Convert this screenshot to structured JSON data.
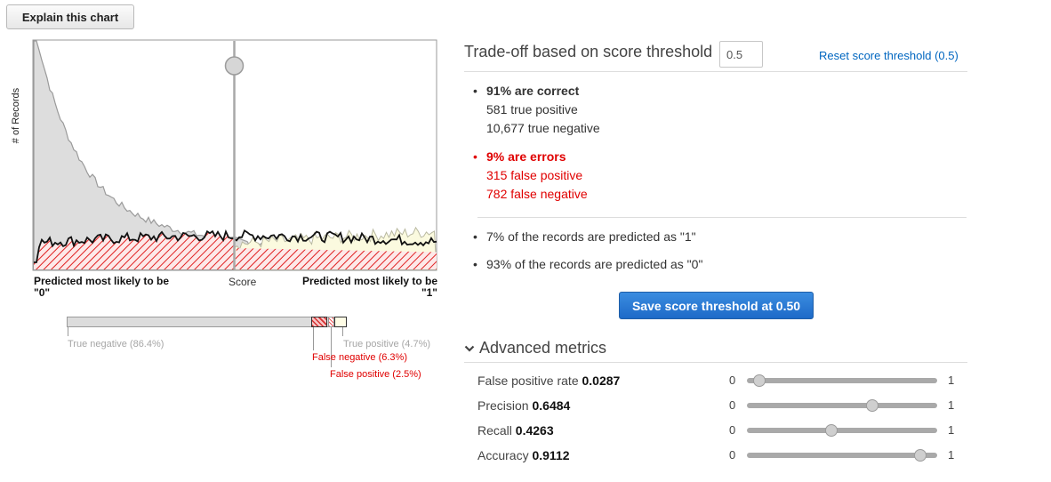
{
  "explain_button": "Explain this chart",
  "chart": {
    "ylabel": "# of Records",
    "xlabel_left_1": "Predicted most likely to be",
    "xlabel_left_2": "\"0\"",
    "xlabel_mid": "Score",
    "xlabel_right_1": "Predicted most likely to be",
    "xlabel_right_2": "\"1\"",
    "threshold": 0.5,
    "colors": {
      "negative_fill": "#dddddd",
      "positive_fill": "#fbfadf",
      "error_hatch": "#e02020",
      "error_line": "#111111"
    }
  },
  "proportions": {
    "true_negative": "True negative (86.4%)",
    "false_negative": "False negative (6.3%)",
    "false_positive": "False positive (2.5%)",
    "true_positive": "True positive (4.7%)",
    "values": {
      "true_negative": 86.4,
      "false_negative": 6.3,
      "false_positive": 2.5,
      "true_positive": 4.7
    }
  },
  "panel": {
    "title": "Trade-off based on score threshold",
    "threshold_value": "0.5",
    "reset_link": "Reset score threshold (0.5)",
    "correct": {
      "heading": "91% are correct",
      "line1": "581 true positive",
      "line2": "10,677 true negative"
    },
    "errors": {
      "heading": "9% are errors",
      "line1": "315 false positive",
      "line2": "782 false negative"
    },
    "predicted_1": "7% of the records are predicted as \"1\"",
    "predicted_0": "93% of the records are predicted as \"0\"",
    "save_button": "Save score threshold at 0.50",
    "advanced": "Advanced metrics",
    "metrics": [
      {
        "label": "False positive rate",
        "value": "0.0287",
        "level": 0.0287,
        "min": "0",
        "max": "1"
      },
      {
        "label": "Precision",
        "value": "0.6484",
        "level": 0.6484,
        "min": "0",
        "max": "1"
      },
      {
        "label": "Recall",
        "value": "0.4263",
        "level": 0.4263,
        "min": "0",
        "max": "1"
      },
      {
        "label": "Accuracy",
        "value": "0.9112",
        "level": 0.9112,
        "min": "0",
        "max": "1"
      }
    ]
  }
}
